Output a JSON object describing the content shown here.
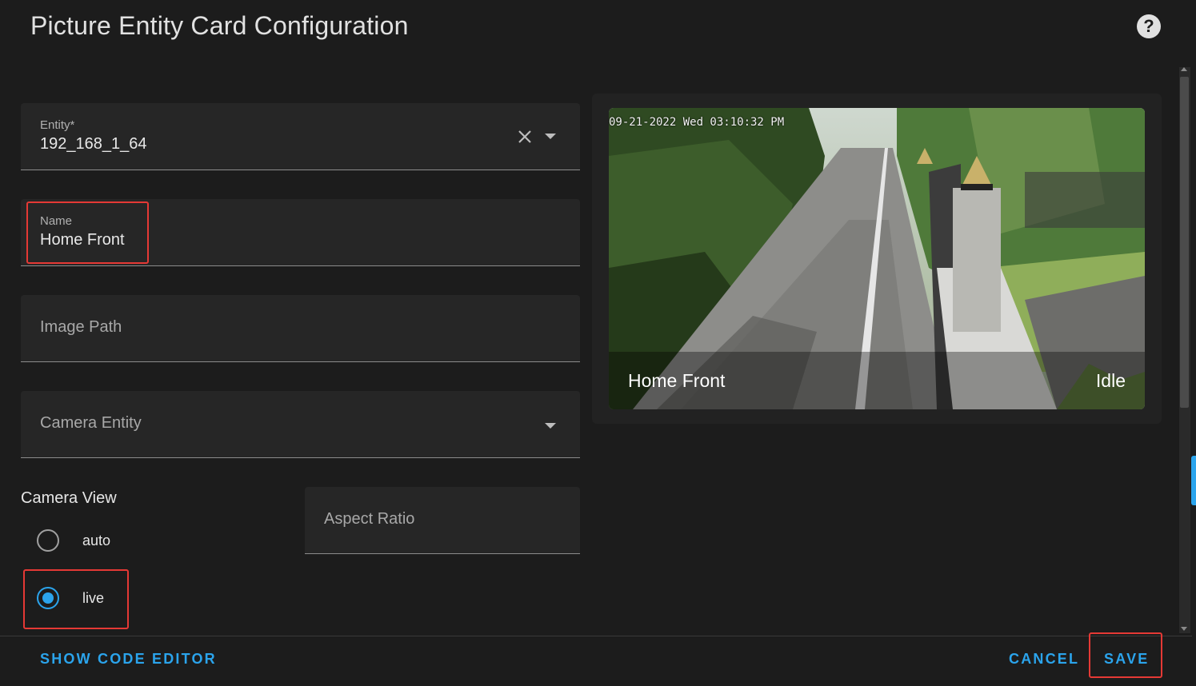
{
  "dialog": {
    "title": "Picture Entity Card Configuration",
    "help_icon": "help-circle-icon"
  },
  "form": {
    "entity": {
      "label": "Entity*",
      "value": "192_168_1_64",
      "clear_icon": "close-icon",
      "dropdown_icon": "chevron-down-icon"
    },
    "name": {
      "label": "Name",
      "value": "Home Front"
    },
    "image_path": {
      "placeholder": "Image Path"
    },
    "camera_entity": {
      "placeholder": "Camera Entity",
      "dropdown_icon": "chevron-down-icon"
    },
    "camera_view": {
      "label": "Camera View",
      "options": [
        {
          "label": "auto",
          "checked": false
        },
        {
          "label": "live",
          "checked": true
        }
      ]
    },
    "aspect_ratio": {
      "placeholder": "Aspect Ratio"
    }
  },
  "preview": {
    "timestamp": "09-21-2022 Wed 03:10:32 PM",
    "name": "Home Front",
    "state": "Idle"
  },
  "footer": {
    "show_code_editor": "SHOW CODE EDITOR",
    "cancel": "CANCEL",
    "save": "SAVE"
  },
  "colors": {
    "accent": "#2ba4ec",
    "highlight_box": "#e53935",
    "background": "#1c1c1c"
  }
}
